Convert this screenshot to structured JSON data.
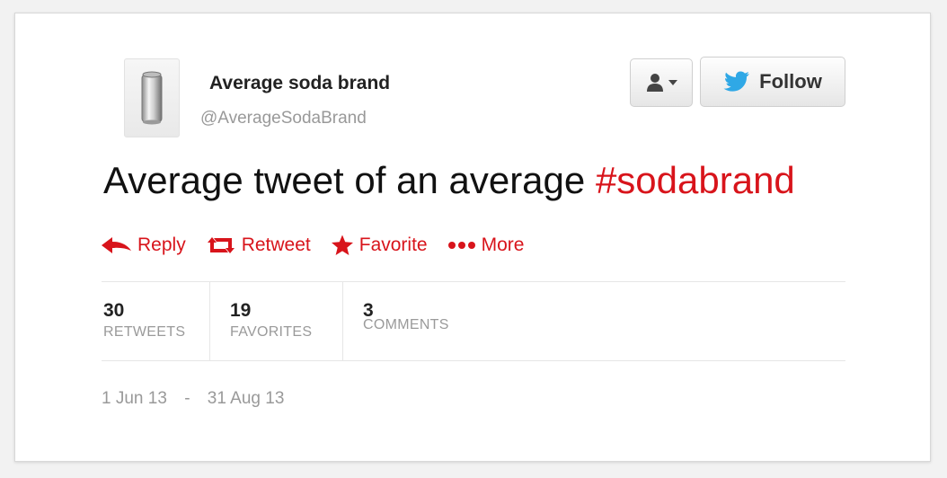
{
  "account": {
    "name": "Average soda brand",
    "handle": "@AverageSodaBrand",
    "avatar_icon": "soda-can-icon"
  },
  "header_buttons": {
    "user_menu_icon": "user-dropdown-icon",
    "follow_label": "Follow",
    "follow_icon": "twitter-bird-icon"
  },
  "tweet": {
    "text": "Average tweet of an average ",
    "hashtag": "#sodabrand"
  },
  "actions": [
    {
      "label": "Reply",
      "icon": "reply-arrow-icon"
    },
    {
      "label": "Retweet",
      "icon": "retweet-icon"
    },
    {
      "label": "Favorite",
      "icon": "star-icon"
    },
    {
      "label": "More",
      "icon": "more-dots-icon"
    }
  ],
  "stats": [
    {
      "count": "30",
      "label": "RETWEETS"
    },
    {
      "count": "19",
      "label": "FAVORITES"
    },
    {
      "count": "3",
      "label": "COMMENTS"
    }
  ],
  "date_range": {
    "start": "1 Jun 13",
    "separator": "-",
    "end": "31 Aug 13"
  },
  "colors": {
    "accent_red": "#d8141b",
    "twitter_blue": "#2fa8e6",
    "muted_text": "#999999"
  }
}
